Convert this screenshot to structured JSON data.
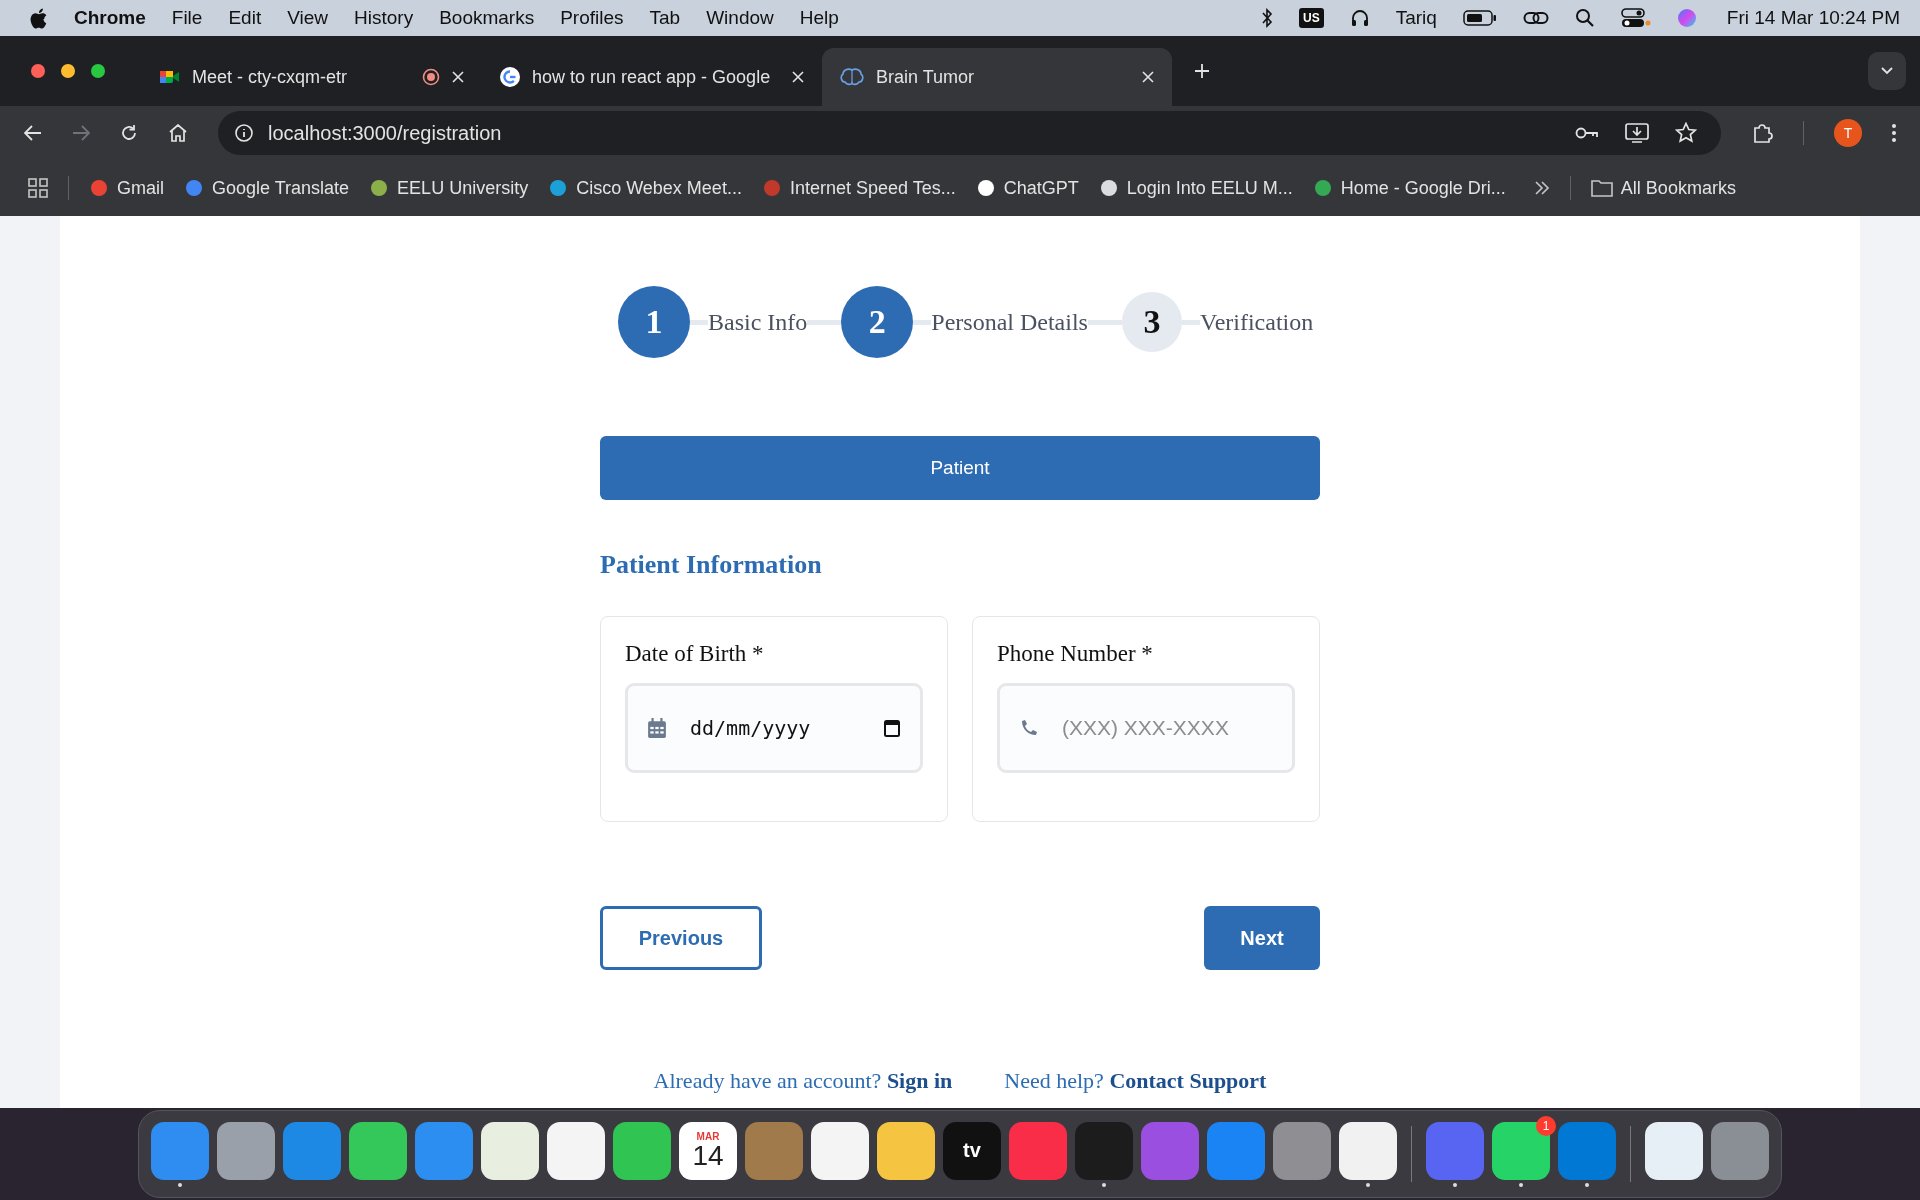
{
  "menu_bar": {
    "app": "Chrome",
    "items": [
      "File",
      "Edit",
      "View",
      "History",
      "Bookmarks",
      "Profiles",
      "Tab",
      "Window",
      "Help"
    ],
    "input_source": "US",
    "user": "Tariq",
    "clock": "Fri 14 Mar  10:24 PM"
  },
  "tabs": [
    {
      "title": "Meet - cty-cxqm-etr",
      "selected": false,
      "recording": true
    },
    {
      "title": "how to run react app - Google",
      "selected": false,
      "recording": false
    },
    {
      "title": "Brain Tumor",
      "selected": true,
      "recording": false
    }
  ],
  "address_bar": {
    "url": "localhost:3000/registration"
  },
  "profile_initial": "T",
  "bookmarks": [
    "Gmail",
    "Google Translate",
    "EELU University",
    "Cisco Webex Meet...",
    "Internet Speed Tes...",
    "ChatGPT",
    "Login Into EELU M...",
    "Home - Google Dri..."
  ],
  "all_bookmarks": "All Bookmarks",
  "steps": [
    {
      "number": "1",
      "label": "Basic Info",
      "done": true
    },
    {
      "number": "2",
      "label": "Personal Details",
      "done": true
    },
    {
      "number": "3",
      "label": "Verification",
      "done": false
    }
  ],
  "role_button": "Patient",
  "section_title": "Patient Information",
  "fields": [
    {
      "label": "Date of Birth *",
      "kind": "date",
      "value": "dd/mm/yyyy"
    },
    {
      "label": "Phone Number *",
      "kind": "phone",
      "placeholder": "(XXX) XXX-XXXX"
    }
  ],
  "previous_button": "Previous",
  "next_button": "Next",
  "footer": [
    {
      "text": "Already have an account?",
      "link": "Sign in"
    },
    {
      "text": "Need help?",
      "link": "Contact Support"
    }
  ],
  "dock": [
    {
      "color": "#2f8cf0",
      "running": true
    },
    {
      "color": "#9aa0aa",
      "running": false
    },
    {
      "color": "#1e88e5",
      "running": false
    },
    {
      "color": "#34c759",
      "running": false
    },
    {
      "color": "#2c8ef0",
      "running": false
    },
    {
      "color": "#e8efe0",
      "running": false
    },
    {
      "color": "#f4f4f4",
      "running": false
    },
    {
      "color": "#30c453",
      "running": false
    },
    {
      "color": "#ffffff",
      "running": false,
      "month": "MAR",
      "day": "14"
    },
    {
      "color": "#a07a4a",
      "running": false
    },
    {
      "color": "#f4f4f4",
      "running": false
    },
    {
      "color": "#f5c542",
      "running": false
    },
    {
      "color": "#111111",
      "running": false,
      "label": "tv"
    },
    {
      "color": "#fa2d48",
      "running": false
    },
    {
      "color": "#1c1c1c",
      "running": true
    },
    {
      "color": "#9a4fe0",
      "running": false
    },
    {
      "color": "#1a84f5",
      "running": false
    },
    {
      "color": "#8e8e93",
      "running": false
    },
    {
      "color": "#f1f1f1",
      "running": true
    },
    {
      "color": "#5865f2",
      "running": true
    },
    {
      "color": "#25d366",
      "running": true,
      "badge": "1"
    },
    {
      "color": "#0078d4",
      "running": true
    },
    {
      "color": "#e6eef6",
      "running": false
    },
    {
      "color": "#8a8f96",
      "running": false
    }
  ]
}
